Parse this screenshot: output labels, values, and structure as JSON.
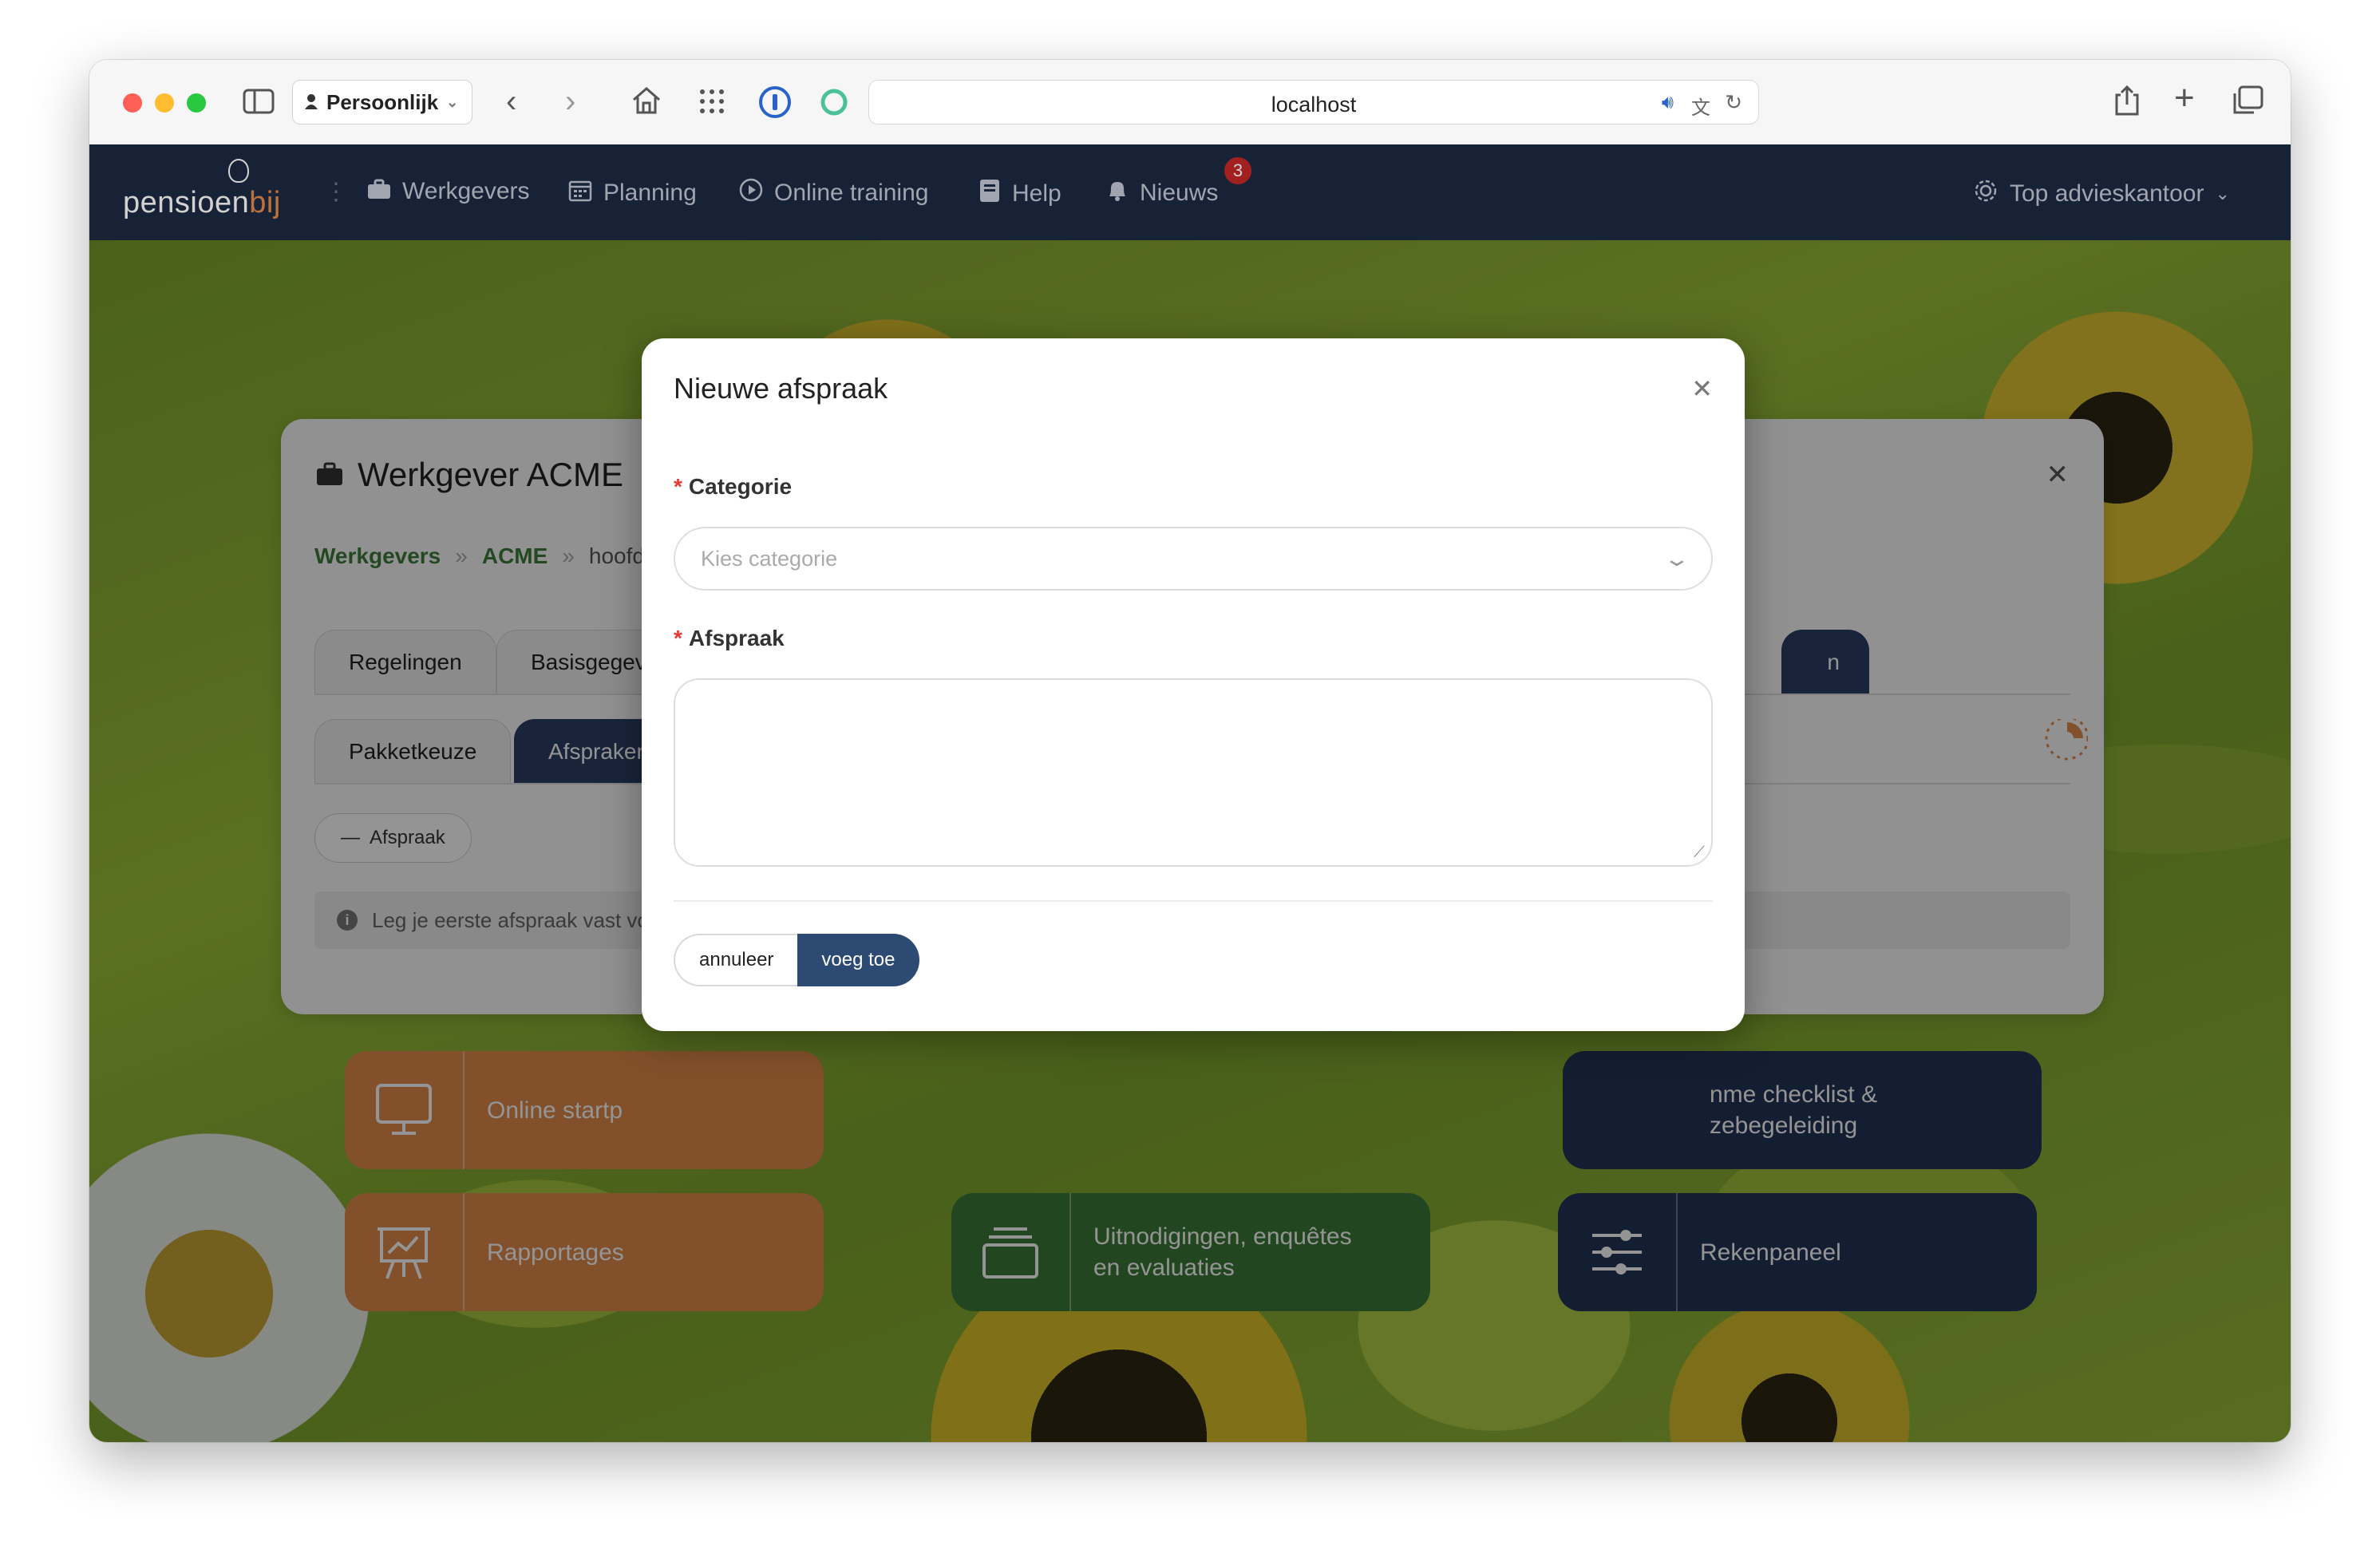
{
  "browser": {
    "profile_label": "Persoonlijk",
    "url": "localhost"
  },
  "nav": {
    "logo_main": "pensioen",
    "logo_accent": "bij",
    "items": [
      {
        "label": "Werkgevers",
        "icon": "briefcase-icon"
      },
      {
        "label": "Planning",
        "icon": "calendar-icon"
      },
      {
        "label": "Online training",
        "icon": "play-circle-icon"
      },
      {
        "label": "Help",
        "icon": "book-icon"
      },
      {
        "label": "Nieuws",
        "icon": "bell-icon"
      }
    ],
    "news_badge": "3",
    "account_label": "Top advieskantoor"
  },
  "card": {
    "title": "Werkgever ACME",
    "breadcrumb": {
      "item1": "Werkgevers",
      "item2": "ACME",
      "item3": "hoofd"
    },
    "tabs_row1": [
      "Regelingen",
      "Basisgegev",
      "n"
    ],
    "tabs_row2": [
      "Pakketkeuze",
      "Afspraken"
    ],
    "add_button": "Afspraak",
    "info_text": "Leg je eerste afspraak vast vo"
  },
  "tiles": [
    {
      "label": "Online startp",
      "color": "#e08a4a",
      "icon": "monitor-icon"
    },
    {
      "label": "nme checklist &\nzebegeleiding",
      "color": "#233456",
      "icon": "checklist-icon"
    },
    {
      "label": "Rapportages",
      "color": "#e08a4a",
      "icon": "presentation-icon"
    },
    {
      "label": "Uitnodigingen, enquêtes\nen evaluaties",
      "color": "#3c7a37",
      "icon": "layers-icon"
    },
    {
      "label": "Rekenpaneel",
      "color": "#233456",
      "icon": "sliders-icon"
    }
  ],
  "modal": {
    "title": "Nieuwe afspraak",
    "category_label": "Categorie",
    "category_placeholder": "Kies categorie",
    "agreement_label": "Afspraak",
    "agreement_value": "",
    "cancel_label": "annuleer",
    "submit_label": "voeg toe",
    "required_marker": "*"
  }
}
